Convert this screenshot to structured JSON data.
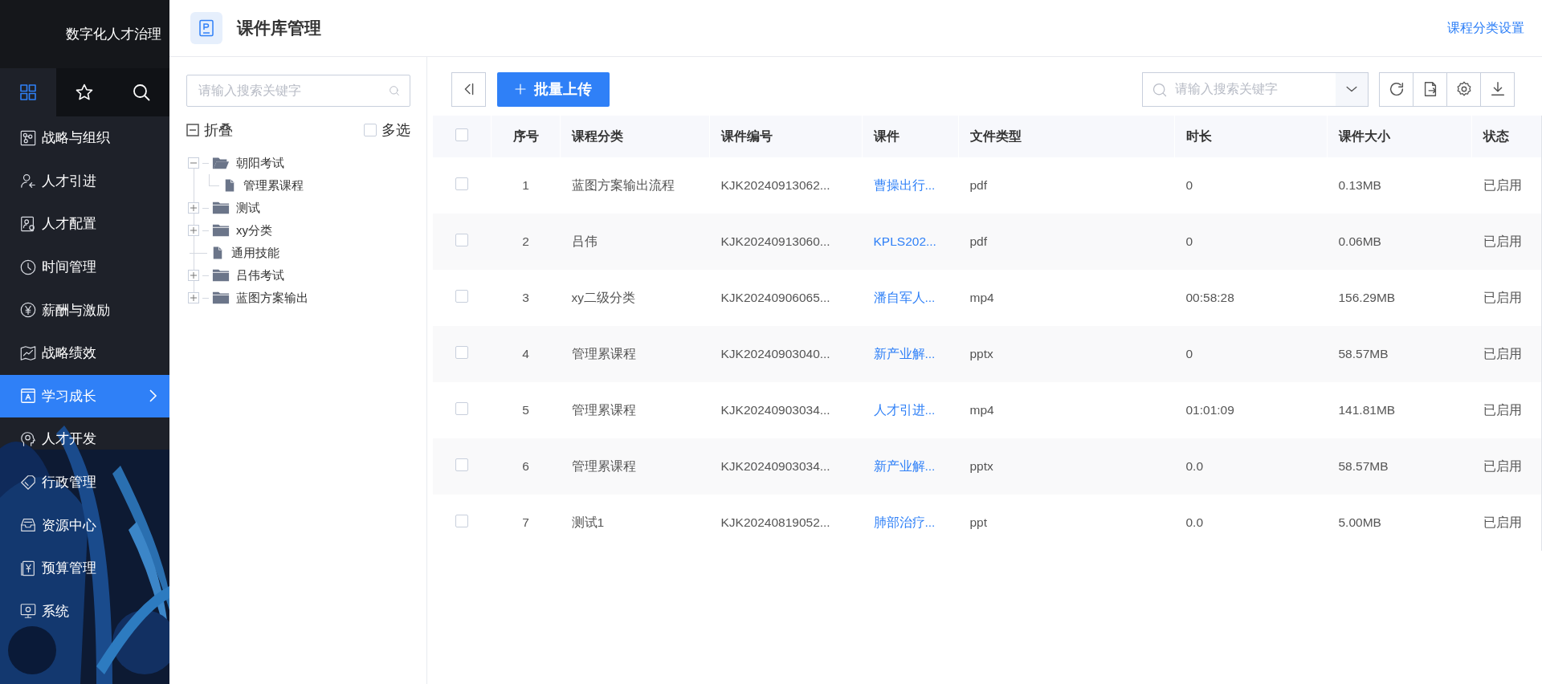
{
  "sidebar": {
    "title": "数字化人才治理",
    "tabs": [
      {
        "kind": "grid",
        "selected": true
      },
      {
        "kind": "star",
        "selected": false
      },
      {
        "kind": "search",
        "selected": false
      }
    ],
    "items": [
      {
        "label": "战略与组织",
        "kind": "org",
        "selected": false
      },
      {
        "label": "人才引进",
        "kind": "person",
        "selected": false
      },
      {
        "label": "人才配置",
        "kind": "card",
        "selected": false
      },
      {
        "label": "时间管理",
        "kind": "clock",
        "selected": false
      },
      {
        "label": "薪酬与激励",
        "kind": "yen",
        "selected": false
      },
      {
        "label": "战略绩效",
        "kind": "trend",
        "selected": false
      },
      {
        "label": "学习成长",
        "kind": "book",
        "selected": true
      },
      {
        "label": "人才开发",
        "kind": "head",
        "selected": false
      },
      {
        "label": "行政管理",
        "kind": "tag",
        "selected": false
      },
      {
        "label": "资源中心",
        "kind": "inbox",
        "selected": false
      },
      {
        "label": "预算管理",
        "kind": "ledger",
        "selected": false
      },
      {
        "label": "系统",
        "kind": "monitor",
        "selected": false
      }
    ]
  },
  "header": {
    "title": "课件库管理",
    "link": "课程分类设置"
  },
  "tree": {
    "search_placeholder": "请输入搜索关键字",
    "collapse_label": "折叠",
    "multi_select": {
      "label": "多选",
      "checked": false
    },
    "nodes": [
      {
        "label": "朝阳考试",
        "kind": "folder",
        "expanded": true,
        "children": [
          {
            "label": "管理累课程",
            "kind": "file"
          }
        ]
      },
      {
        "label": "测试",
        "kind": "folder",
        "expanded": false
      },
      {
        "label": "xy分类",
        "kind": "folder",
        "expanded": false
      },
      {
        "label": "通用技能",
        "kind": "file"
      },
      {
        "label": "吕伟考试",
        "kind": "folder",
        "expanded": false
      },
      {
        "label": "蓝图方案输出",
        "kind": "folder",
        "expanded": false
      }
    ]
  },
  "toolbar": {
    "upload_button": "批量上传",
    "search_placeholder": "请输入搜索关键字"
  },
  "table": {
    "all_checked": false,
    "columns": [
      {
        "label": "序号",
        "kind": "center"
      },
      {
        "label": "课程分类",
        "kind": "text"
      },
      {
        "label": "课件编号",
        "kind": "text"
      },
      {
        "label": "课件",
        "kind": "link"
      },
      {
        "label": "文件类型",
        "kind": "text"
      },
      {
        "label": "时长",
        "kind": "text"
      },
      {
        "label": "课件大小",
        "kind": "text"
      },
      {
        "label": "状态",
        "kind": "text"
      }
    ],
    "rows": [
      {
        "checked": false,
        "cells": [
          "1",
          "蓝图方案输出流程",
          "KJK20240913062...",
          "曹操出行...",
          "pdf",
          "0",
          "0.13MB",
          "已启用"
        ]
      },
      {
        "checked": false,
        "cells": [
          "2",
          "吕伟",
          "KJK20240913060...",
          "KPLS202...",
          "pdf",
          "0",
          "0.06MB",
          "已启用"
        ]
      },
      {
        "checked": false,
        "cells": [
          "3",
          "xy二级分类",
          "KJK20240906065...",
          "潘自军人...",
          "mp4",
          "00:58:28",
          "156.29MB",
          "已启用"
        ]
      },
      {
        "checked": false,
        "cells": [
          "4",
          "管理累课程",
          "KJK20240903040...",
          "新产业解...",
          "pptx",
          "0",
          "58.57MB",
          "已启用"
        ]
      },
      {
        "checked": false,
        "cells": [
          "5",
          "管理累课程",
          "KJK20240903034...",
          "人才引进...",
          "mp4",
          "01:01:09",
          "141.81MB",
          "已启用"
        ]
      },
      {
        "checked": false,
        "cells": [
          "6",
          "管理累课程",
          "KJK20240903034...",
          "新产业解...",
          "pptx",
          "0.0",
          "58.57MB",
          "已启用"
        ]
      },
      {
        "checked": false,
        "cells": [
          "7",
          "测试1",
          "KJK20240819052...",
          "肺部治疗...",
          "ppt",
          "0.0",
          "5.00MB",
          "已启用"
        ]
      }
    ]
  }
}
